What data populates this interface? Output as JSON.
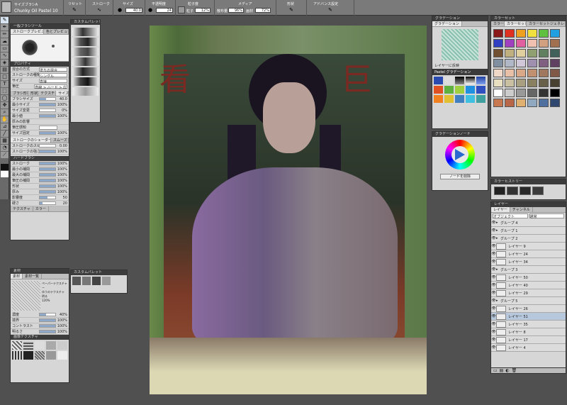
{
  "toolbar": {
    "subtool_top": "サイズブラシA",
    "subtool_name": "Chunky Oil Pastel 10",
    "groups": [
      {
        "label": "リセット"
      },
      {
        "label": "ストローク"
      },
      {
        "label": "サイズ"
      },
      {
        "label": "不透明度"
      },
      {
        "label": "粒子度"
      },
      {
        "label": "メディア"
      },
      {
        "label": "形状"
      },
      {
        "label": "アドバンス設定"
      }
    ],
    "size_value": "40.0",
    "opacity_value": "24",
    "grain_label": "粒子",
    "grain_value": "12%",
    "density_label": "散布量",
    "density_value": "96%",
    "media_label": "画材",
    "media_value": "100%",
    "blend_value": "72%"
  },
  "subtool_panel": {
    "title": "一般ブラシツール",
    "tabs": [
      "ストロークプレビュー",
      "色とプレビュー"
    ],
    "brush_label": "カスタムパレット",
    "props_title": "プロパティ",
    "blend": {
      "label": "混合の方式",
      "value": "塗りの混合"
    },
    "stroke": {
      "label": "ストロークの種類",
      "value": "シングル"
    },
    "size_mode": {
      "label": "サイズ",
      "value": "直接"
    },
    "pressure": {
      "label": "筆圧",
      "value": "直線 > ハード > 広"
    },
    "tabs2": [
      "ブラシ形状",
      "形状",
      "テクスチャ",
      "ストローク",
      "サイズ"
    ],
    "size": {
      "label": "ブラシサイズ",
      "value": "40.0"
    },
    "min_size": {
      "label": "最小サイズ",
      "value": "100%"
    },
    "rows": [
      {
        "label": "サイズ変更",
        "value": "0%"
      },
      {
        "label": "最小値",
        "value": "100%"
      },
      {
        "label": "厚みの影響",
        "value": ""
      },
      {
        "label": "筆圧感知",
        "value": ""
      },
      {
        "label": "サイズ固定",
        "value": "100%"
      }
    ],
    "stroke_tab": "ストロークのシェーダー",
    "smooth_tab": "スムーズ",
    "stroke_rows": [
      {
        "label": "ストロークのスピード",
        "value": "0.00"
      },
      {
        "label": "ストロークの強さ",
        "value": "100%"
      }
    ],
    "hard_title": "ハードブラシ",
    "hard_rows": [
      {
        "label": "ストローク",
        "value": "100%"
      },
      {
        "label": "最小の補間",
        "value": "100%"
      },
      {
        "label": "最大の補間",
        "value": "100%"
      },
      {
        "label": "筆圧の補間",
        "value": "100%"
      },
      {
        "label": "形状",
        "value": "100%"
      },
      {
        "label": "厚み",
        "value": "100%"
      },
      {
        "label": "割り当て",
        "value": ""
      },
      {
        "label": "影響度",
        "value": "50"
      },
      {
        "label": "硬さ",
        "value": "20"
      }
    ],
    "texture_tab": "テクスチャ",
    "color_tab": "カラー"
  },
  "texture_panel": {
    "title": "素材",
    "tabs": [
      "素材",
      "素材一覧"
    ],
    "info": [
      "ペーパーテクスチャー",
      "ゆうのテクスチャ",
      "明る",
      "120%"
    ],
    "rows": [
      {
        "label": "濃度",
        "value": "40%"
      },
      {
        "label": "境界",
        "value": "100%"
      },
      {
        "label": "コントラスト",
        "value": "100%"
      },
      {
        "label": "明るさ",
        "value": "100%"
      }
    ],
    "list_title": "画像テクスチャ"
  },
  "custom_palette": {
    "title": "カスタムパレット"
  },
  "gradation_panel": {
    "title": "グラデーション",
    "tab": "グラデーション",
    "link_label": "レイヤーに反映",
    "set_label": "Pastel グラデーション"
  },
  "color_wheel_panel": {
    "title": "グラデーションノード",
    "btn": "ノードを削除"
  },
  "colorset_panel": {
    "title": "カラーセット",
    "tabs": [
      "カラー",
      "カラーセット",
      "カラーセットジェネレータ"
    ]
  },
  "sub_panel": {
    "title": "カラーヒストリー"
  },
  "layer_panel": {
    "title": "レイヤー",
    "tabs": [
      "レイヤー",
      "チャンネル"
    ],
    "blend_mode": "オブジェクト",
    "mode2": "通常",
    "layers": [
      {
        "name": "グループ 4",
        "group": true,
        "selected": false
      },
      {
        "name": "グループ 1",
        "group": true,
        "selected": false
      },
      {
        "name": "グループ 2",
        "group": true,
        "selected": false
      },
      {
        "name": "レイヤー 9",
        "group": false,
        "selected": false
      },
      {
        "name": "レイヤー 24",
        "group": false,
        "selected": false
      },
      {
        "name": "レイヤー 34",
        "group": false,
        "selected": false
      },
      {
        "name": "グループ 3",
        "group": true,
        "selected": false
      },
      {
        "name": "レイヤー 50",
        "group": false,
        "selected": false
      },
      {
        "name": "レイヤー 40",
        "group": false,
        "selected": false
      },
      {
        "name": "レイヤー 29",
        "group": false,
        "selected": false
      },
      {
        "name": "グループ 5",
        "group": true,
        "selected": false
      },
      {
        "name": "レイヤー 26",
        "group": false,
        "selected": false
      },
      {
        "name": "レイヤー 51",
        "group": false,
        "selected": true
      },
      {
        "name": "レイヤー 35",
        "group": false,
        "selected": false
      },
      {
        "name": "レイヤー 8",
        "group": false,
        "selected": false
      },
      {
        "name": "レイヤー 17",
        "group": false,
        "selected": false
      },
      {
        "name": "レイヤー 4",
        "group": false,
        "selected": false
      }
    ]
  },
  "canvas": {
    "signs": [
      "看",
      "巨"
    ]
  },
  "colors": {
    "accent": "#8fa8c8",
    "panel": "#d6d6d6",
    "workspace": "#505050"
  }
}
